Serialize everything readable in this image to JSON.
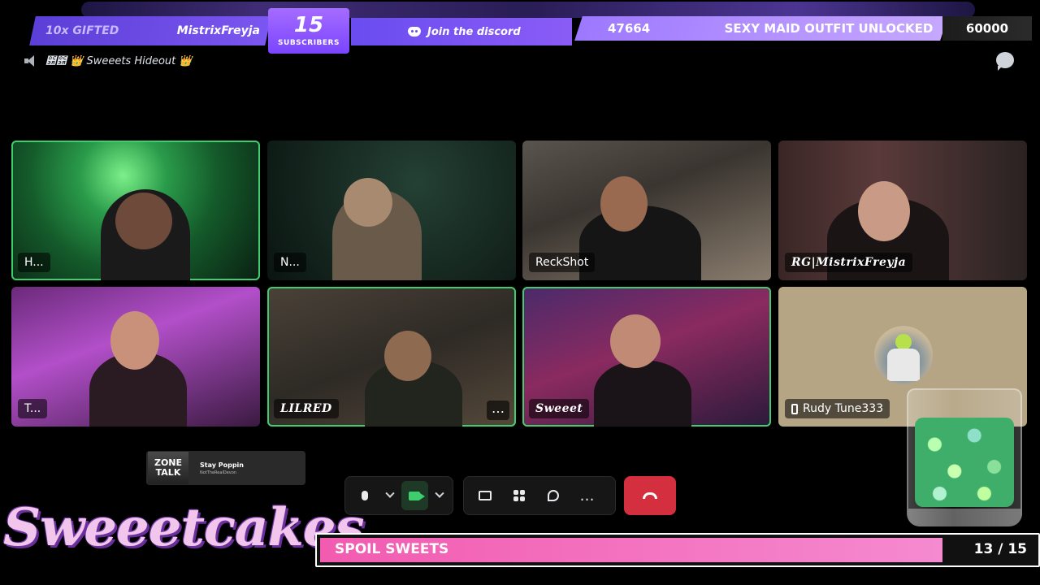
{
  "overlay": {
    "gifted": "10x GIFTED",
    "gifter": "MistrixFreyja",
    "subscribers_count": "15",
    "subscribers_label": "SUBSCRIBERS",
    "discord": "Join the discord",
    "goal_current": "47664",
    "goal_message": "SEXY MAID OUTFIT UNLOCKED",
    "goal_target": "60000"
  },
  "channel": {
    "name": "఺఺ 👑 Sweeets Hideout 👑"
  },
  "tiles": [
    {
      "name": "H..."
    },
    {
      "name": "N..."
    },
    {
      "name": "ReckShot"
    },
    {
      "name": "RG|MistrixFreyja"
    },
    {
      "name": "T..."
    },
    {
      "name": "LILRED"
    },
    {
      "name": "Sweeet"
    },
    {
      "name": "Rudy Tune333"
    }
  ],
  "now_playing": {
    "art_line1": "ZONE",
    "art_line2": "TALK",
    "title": "Stay Poppin",
    "artist": "NotTheRealDevon"
  },
  "controls": {
    "more": "…",
    "tile_more": "…"
  },
  "bottom": {
    "logo": "Sweeetcakes",
    "spoil_label": "SPOIL SWEETS",
    "spoil_count": "13 / 15",
    "spoil_progress": 0.87
  },
  "colors": {
    "accent_purple": "#7b56f0",
    "speaking_green": "#3fce6e",
    "hangup_red": "#d32f3f",
    "spoil_pink": "#f25bb0"
  }
}
